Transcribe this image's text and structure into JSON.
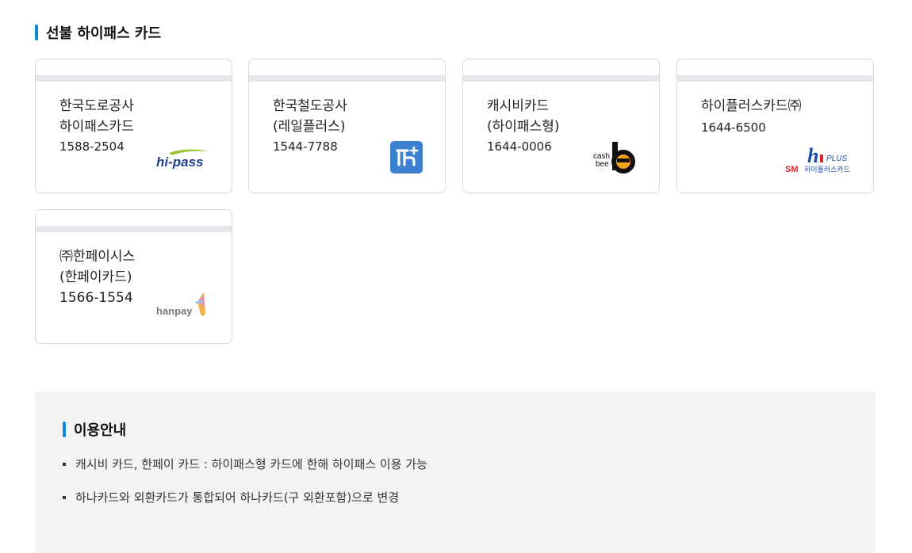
{
  "prepaid": {
    "title": "선불 하이패스 카드",
    "cards": [
      {
        "name1": "한국도로공사",
        "name2": "하이패스카드",
        "phone": "1588-2504",
        "logo": "hi-pass-logo",
        "logo_text": "hi-pass"
      },
      {
        "name1": "한국철도공사",
        "name2": "(레일플러스)",
        "phone": "1544-7788",
        "logo": "rail-plus-logo"
      },
      {
        "name1": "캐시비카드",
        "name2": "(하이패스형)",
        "phone": "1644-0006",
        "logo": "cashbee-logo",
        "logo_text1": "cash",
        "logo_text2": "bee"
      },
      {
        "name1": "하이플러스카드㈜",
        "name2": "",
        "phone": "1644-6500",
        "logo": "hiplus-logo",
        "logo_text1": "SM",
        "logo_text2": "하이플러스카드",
        "logo_text3": "PLUS"
      },
      {
        "name1": "㈜한페이시스",
        "name2": "(한페이카드)",
        "phone": "1566-1554",
        "logo": "hanpay-logo",
        "logo_text": "hanpay"
      }
    ]
  },
  "info": {
    "title": "이용안내",
    "items": [
      "캐시비 카드, 한페이 카드 : 하이패스형 카드에 한해 하이패스 이용 가능",
      "하나카드와 외환카드가 통합되어 하나카드(구 외환포함)으로 변경"
    ]
  },
  "colors": {
    "accent": "#0b8ad8",
    "strip": "#e5e7ea",
    "panel": "#f3f3f4"
  }
}
